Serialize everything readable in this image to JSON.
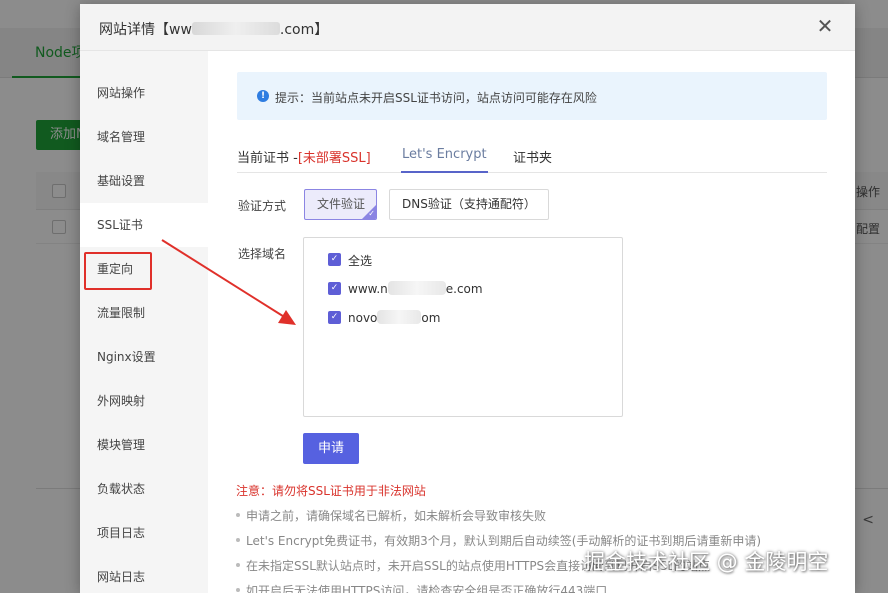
{
  "background": {
    "tab_label": "Node项",
    "add_button": "添加N",
    "right_header": "操作",
    "right_cell": "配置",
    "pager": "<"
  },
  "modal": {
    "title_prefix": "网站详情【ww",
    "title_suffix": ".com】",
    "close_icon": "close-icon"
  },
  "sidebar": {
    "items": [
      {
        "label": "网站操作"
      },
      {
        "label": "域名管理"
      },
      {
        "label": "基础设置"
      },
      {
        "label": "SSL证书"
      },
      {
        "label": "重定向"
      },
      {
        "label": "流量限制"
      },
      {
        "label": "Nginx设置"
      },
      {
        "label": "外网映射"
      },
      {
        "label": "模块管理"
      },
      {
        "label": "负载状态"
      },
      {
        "label": "项目日志"
      },
      {
        "label": "网站日志"
      }
    ],
    "active_index": 3
  },
  "tip": {
    "icon": "info-icon",
    "text": "提示：当前站点未开启SSL证书访问，站点访问可能存在风险"
  },
  "tabs": {
    "current_prefix": "当前证书 -",
    "current_status": "[未部署SSL]",
    "lets_encrypt": "Let's Encrypt",
    "cert_folder": "证书夹"
  },
  "verify": {
    "label": "验证方式",
    "file_option": "文件验证",
    "dns_option": "DNS验证（支持通配符）",
    "selected": "文件验证"
  },
  "domains": {
    "label": "选择域名",
    "select_all": "全选",
    "items": [
      {
        "prefix": "www.n",
        "suffix": "e.com",
        "checked": true
      },
      {
        "prefix": "novo",
        "suffix": "om",
        "checked": true
      }
    ]
  },
  "apply_button": "申请",
  "notice": {
    "title": "注意：请勿将SSL证书用于非法网站",
    "items": [
      "申请之前，请确保域名已解析，如未解析会导致审核失败",
      "Let's Encrypt免费证书，有效期3个月，默认到期后自动续签(手动解析的证书到期后请重新申请)",
      "在未指定SSL默认站点时，未开启SSL的站点使用HTTPS会直接访问到已开启SSL的站点",
      "如开启后无法使用HTTPS访问，请检查安全组是否正确放行443端口"
    ]
  },
  "watermark": "掘金技术社区 @ 金陵明空",
  "colors": {
    "accent": "#5661e0",
    "highlight_red": "#e0302a",
    "warning_red": "#d9332c",
    "tip_bg": "#eaf4fd"
  }
}
